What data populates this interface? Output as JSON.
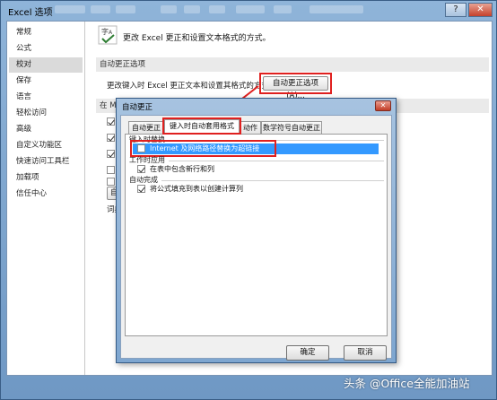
{
  "window": {
    "title": "Excel 选项"
  },
  "nav": {
    "items": [
      {
        "label": "常规",
        "selected": false
      },
      {
        "label": "公式",
        "selected": false
      },
      {
        "label": "校对",
        "selected": true
      },
      {
        "label": "保存",
        "selected": false
      },
      {
        "label": "语言",
        "selected": false
      },
      {
        "label": "轻松访问",
        "selected": false
      },
      {
        "label": "高级",
        "selected": false
      },
      {
        "label": "自定义功能区",
        "selected": false
      },
      {
        "label": "快速访问工具栏",
        "selected": false
      },
      {
        "label": "加载项",
        "selected": false
      },
      {
        "label": "信任中心",
        "selected": false
      }
    ]
  },
  "pane": {
    "intro": "更改 Excel 更正和设置文本格式的方式。",
    "autocorrect_section": "自动更正选项",
    "autocorrect_desc": "更改键入时 Excel 更正文本和设置其格式的方式:",
    "autocorrect_button": "自动更正选项(A)...",
    "office_section_prefix": "在 Mi",
    "left_fragments": [
      "忽",
      "忽",
      "忽",
      "标",
      "仅"
    ],
    "custom_button_fragment": "自定",
    "dict_fragment": "词典"
  },
  "dialog": {
    "title": "自动更正",
    "close_label": "✕",
    "tabs": [
      "自动更正",
      "键入时自动套用格式",
      "动作",
      "数学符号自动更正"
    ],
    "active_tab": 1,
    "group_replace": "键入时替换",
    "option_internet": "Internet 及网络路径替换为超链接",
    "option_internet_checked": false,
    "group_apply": "工作时应用",
    "option_table_rows": "在表中包含新行和列",
    "option_table_rows_checked": true,
    "group_auto_fill": "自动完成",
    "option_formulas": "将公式填充到表以创建计算列",
    "option_formulas_checked": true,
    "ok_button": "确定",
    "cancel_button": "取消"
  },
  "watermark": "头条 @Office全能加油站",
  "colors": {
    "highlight": "#3399ff",
    "annotation_red": "#e0201f"
  }
}
